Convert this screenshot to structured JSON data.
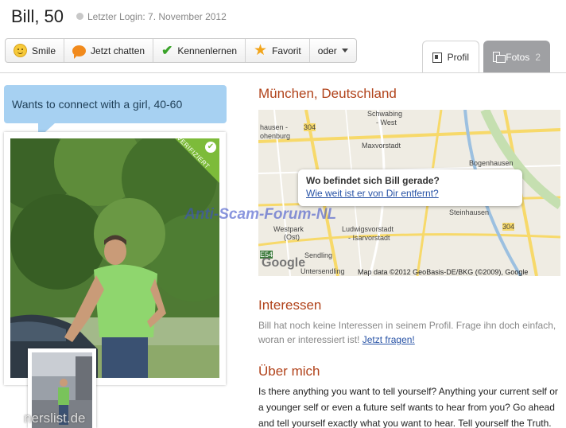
{
  "header": {
    "name": "Bill, 50",
    "last_login": "Letzter Login: 7. November 2012"
  },
  "actions": [
    {
      "label": "Smile",
      "icon": "smile-icon"
    },
    {
      "label": "Jetzt chatten",
      "icon": "chat-bubble-icon"
    },
    {
      "label": "Kennenlernen",
      "icon": "checkmark-icon"
    },
    {
      "label": "Favorit",
      "icon": "star-icon"
    },
    {
      "label": "oder",
      "icon": "chevron-down-icon"
    }
  ],
  "tabs": {
    "profil": "Profil",
    "fotos": "Fotos",
    "fotos_count": "2"
  },
  "bubble": "Wants to connect with a girl, 40-60",
  "verified_badge": "VERIFIZIERT",
  "location": {
    "title": "München, Deutschland",
    "popup_question": "Wo befindet sich Bill gerade?",
    "popup_link": "Wie weit ist er von Dir entfernt?",
    "map_copyright": "Map data ©2012 GeoBasis-DE/BKG (©2009), Google",
    "map_logo": "Google",
    "map_labels": [
      "hausen -",
      "ohenburg",
      "304",
      "Schwabing",
      "- West",
      "Maxvorstadt",
      "Bogenhausen",
      "Steinhausen",
      "Westpark",
      "(Ost)",
      "Ludwigsvorstadt",
      "- Isarvorstadt",
      "Sendling",
      "E54",
      "Untersendling",
      "304"
    ]
  },
  "interessen": {
    "title": "Interessen",
    "text": "Bill hat noch keine Interessen in seinem Profil. Frage ihn doch einfach, woran er interessiert ist!",
    "link": "Jetzt fragen!"
  },
  "about": {
    "title": "Über mich",
    "text": "Is there anything you want to tell yourself? Anything your current self or a younger self or even a future self wants to hear from you? Go ahead and tell yourself exactly what you want to hear. Tell yourself the Truth."
  },
  "watermarks": {
    "center": "Anti-Scam-Forum-NL",
    "bottom": "nerslist.de"
  },
  "colors": {
    "accent": "#b1431b",
    "bubble": "#a7d1f2",
    "verified": "#7dbb3a",
    "link": "#2853a6"
  }
}
